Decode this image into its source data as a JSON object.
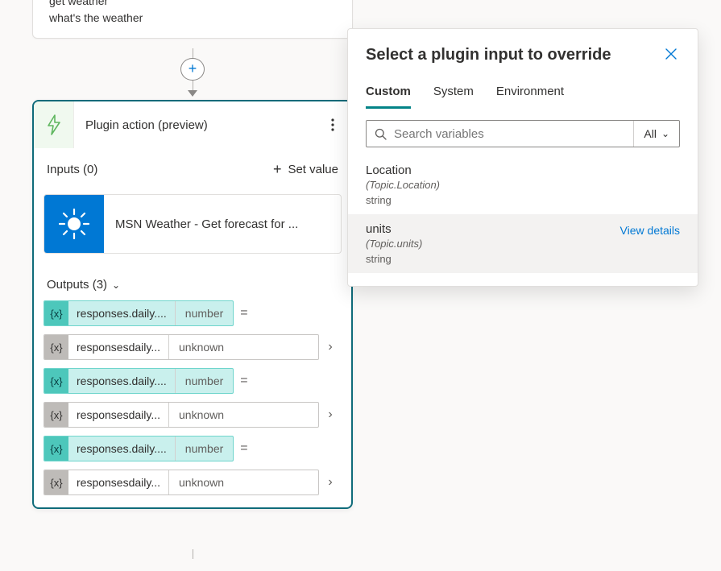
{
  "trigger": {
    "line1": "get weather",
    "line2": "what's the weather"
  },
  "add_button_glyph": "+",
  "plugin_card": {
    "title": "Plugin action (preview)",
    "icon_name": "lightning-icon",
    "inputs_label": "Inputs (0)",
    "set_value_label": "Set value",
    "connector_label": "MSN Weather - Get forecast for ...",
    "outputs_label": "Outputs (3)",
    "outputs": [
      {
        "style": "teal",
        "name": "responses.daily....",
        "type": "number",
        "trailing": "="
      },
      {
        "style": "full",
        "name": "responsesdaily...",
        "type": "unknown",
        "trailing": ">"
      },
      {
        "style": "teal",
        "name": "responses.daily....",
        "type": "number",
        "trailing": "="
      },
      {
        "style": "full",
        "name": "responsesdaily...",
        "type": "unknown",
        "trailing": ">"
      },
      {
        "style": "teal",
        "name": "responses.daily....",
        "type": "number",
        "trailing": "="
      },
      {
        "style": "full",
        "name": "responsesdaily...",
        "type": "unknown",
        "trailing": ">"
      }
    ]
  },
  "panel": {
    "title": "Select a plugin input to override",
    "tabs": [
      "Custom",
      "System",
      "Environment"
    ],
    "active_tab": 0,
    "search_placeholder": "Search variables",
    "filter_label": "All",
    "view_details_label": "View details",
    "variables": [
      {
        "name": "Location",
        "path": "(Topic.Location)",
        "type": "string",
        "selected": false
      },
      {
        "name": "units",
        "path": "(Topic.units)",
        "type": "string",
        "selected": true
      }
    ]
  }
}
